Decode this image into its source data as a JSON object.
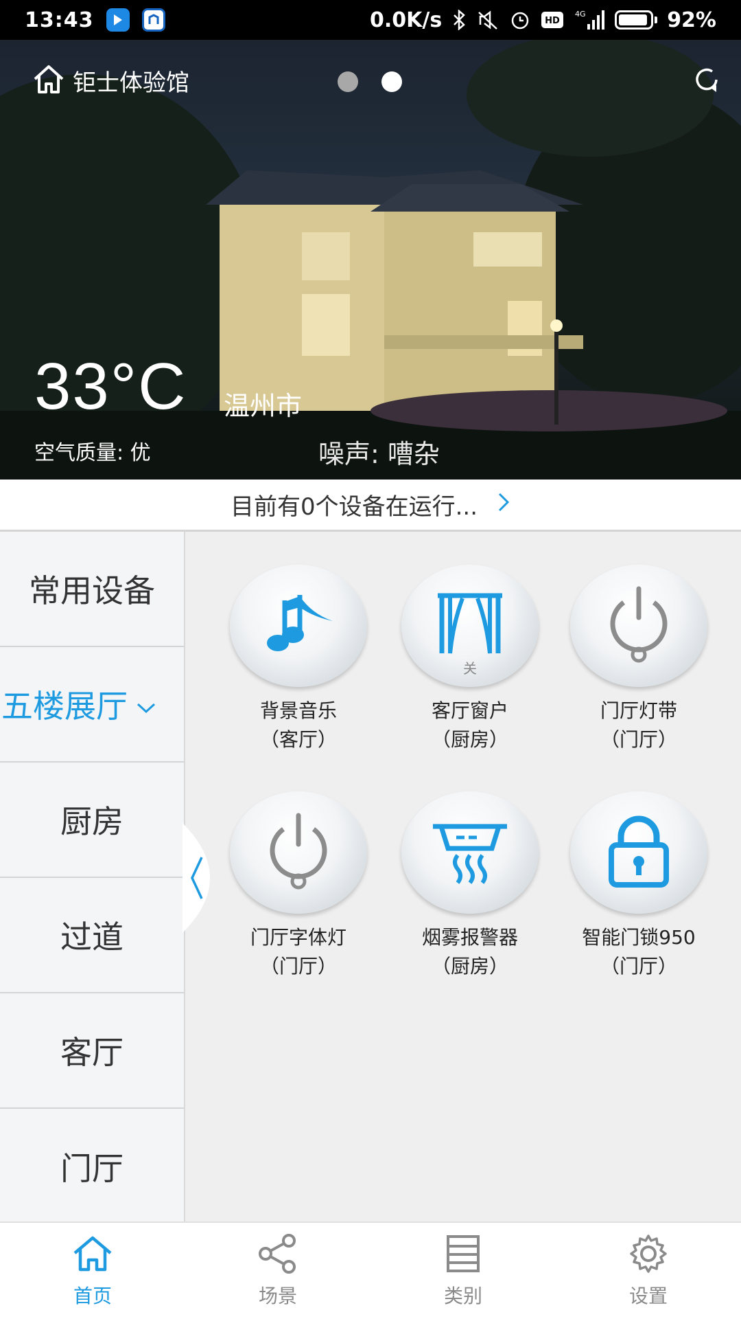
{
  "status_bar": {
    "time": "13:43",
    "network_speed": "0.0K/s",
    "signal_label": "4G",
    "hd_label": "HD",
    "battery_percent_text": "92%",
    "battery_level": 0.92
  },
  "hero": {
    "home_name": "钜士体验馆",
    "page_dots": [
      {
        "active": false
      },
      {
        "active": true
      }
    ],
    "temperature": "33°C",
    "city": "温州市",
    "air_quality": "空气质量: 优",
    "noise": "噪声: 嘈杂"
  },
  "running_bar": {
    "text": "目前有0个设备在运行..."
  },
  "sidebar": {
    "items": [
      {
        "label": "常用设备",
        "active": false
      },
      {
        "label": "五楼展厅",
        "active": true
      },
      {
        "label": "厨房",
        "active": false
      },
      {
        "label": "过道",
        "active": false
      },
      {
        "label": "客厅",
        "active": false
      },
      {
        "label": "门厅",
        "active": false
      }
    ]
  },
  "devices": [
    {
      "name": "背景音乐",
      "room": "（客厅）",
      "icon": "music-note-icon"
    },
    {
      "name": "客厅窗户",
      "room": "（厨房）",
      "icon": "curtain-icon",
      "state": "关"
    },
    {
      "name": "门厅灯带",
      "room": "（门厅）",
      "icon": "power-icon"
    },
    {
      "name": "门厅字体灯",
      "room": "（门厅）",
      "icon": "power-icon"
    },
    {
      "name": "烟雾报警器",
      "room": "（厨房）",
      "icon": "smoke-alarm-icon"
    },
    {
      "name": "智能门锁950",
      "room": "（门厅）",
      "icon": "lock-icon"
    }
  ],
  "bottom_nav": {
    "items": [
      {
        "label": "首页",
        "icon": "home-icon",
        "active": true
      },
      {
        "label": "场景",
        "icon": "share-icon",
        "active": false
      },
      {
        "label": "类别",
        "icon": "category-icon",
        "active": false
      },
      {
        "label": "设置",
        "icon": "gear-icon",
        "active": false
      }
    ]
  },
  "colors": {
    "accent": "#1e9be0",
    "icon_blue": "#1e9be0",
    "icon_gray": "#8c8c8c"
  }
}
